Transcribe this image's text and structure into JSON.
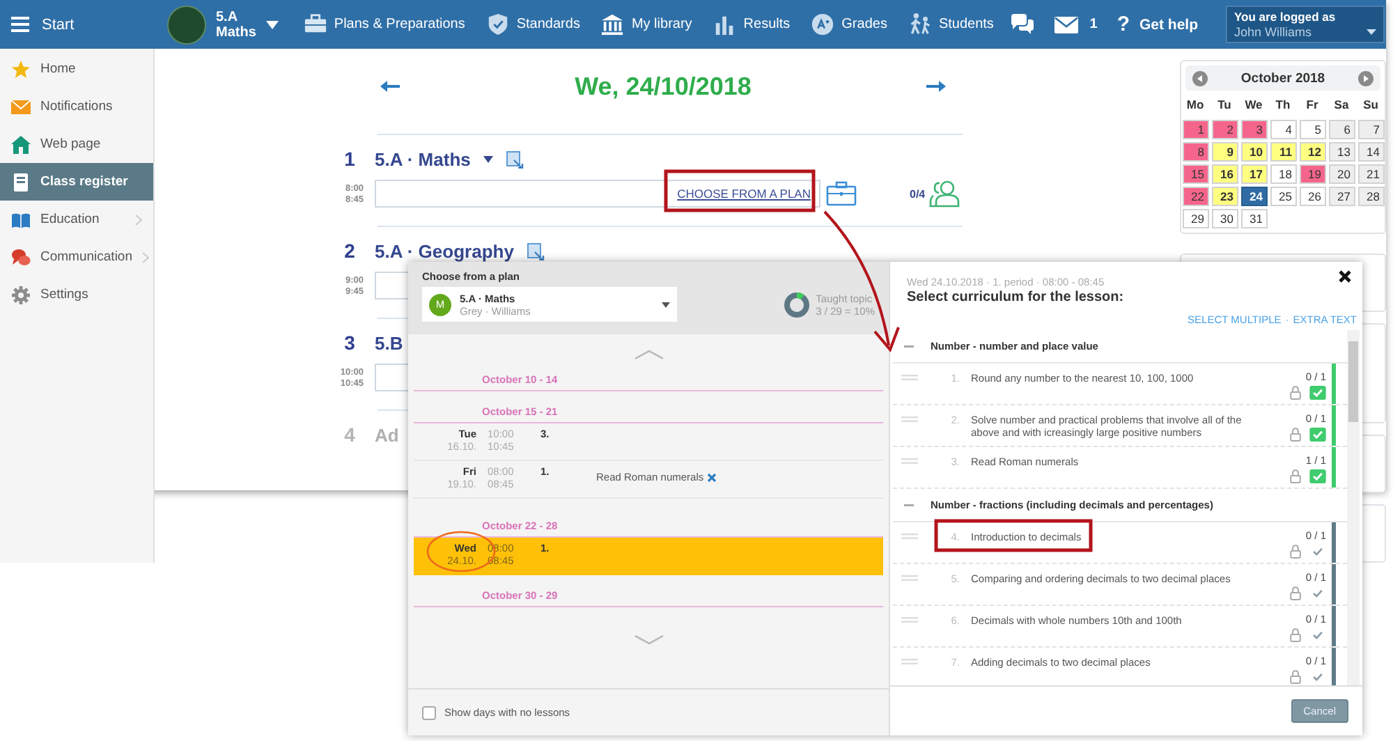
{
  "topbar": {
    "menu_label": "Start",
    "class": {
      "name": "5.A",
      "subject": "Maths"
    },
    "nav": [
      {
        "label": "Plans & Preparations",
        "kind": "plans"
      },
      {
        "label": "Standards",
        "kind": "standards"
      },
      {
        "label": "My library",
        "kind": "library"
      },
      {
        "label": "Results",
        "kind": "results"
      },
      {
        "label": "Grades",
        "kind": "grades"
      },
      {
        "label": "Students",
        "kind": "students"
      }
    ],
    "messages_count": "1",
    "help_mark": "?",
    "help": "Get help",
    "user": {
      "caption": "You are logged as",
      "name": "John Williams"
    }
  },
  "sidebar": {
    "items": [
      {
        "label": "Home",
        "kind": "star",
        "selected": false,
        "expandable": false
      },
      {
        "label": "Notifications",
        "kind": "envelope",
        "selected": false,
        "expandable": false
      },
      {
        "label": "Web page",
        "kind": "house",
        "selected": false,
        "expandable": false
      },
      {
        "label": "Class register",
        "kind": "notebook",
        "selected": true,
        "expandable": false
      },
      {
        "label": "Education",
        "kind": "book",
        "selected": false,
        "expandable": true
      },
      {
        "label": "Communication",
        "kind": "chat",
        "selected": false,
        "expandable": true
      },
      {
        "label": "Settings",
        "kind": "gear",
        "selected": false,
        "expandable": false
      }
    ]
  },
  "day": {
    "title": "We, 24/10/2018",
    "lessons": [
      {
        "kind": "lesson",
        "number": "1",
        "start": "8:00",
        "end": "8:45",
        "title": "5.A · Maths",
        "menu": true,
        "edit": true,
        "link": "CHOOSE FROM A PLAN",
        "attendance": "0/4"
      },
      {
        "kind": "lesson",
        "number": "2",
        "start": "9:00",
        "end": "9:45",
        "title": "5.A · Geography",
        "menu": false,
        "edit": true
      },
      {
        "kind": "lesson",
        "number": "3",
        "start": "10:00",
        "end": "10:45",
        "title": "5.B",
        "menu": false,
        "edit": false
      },
      {
        "kind": "add",
        "number": "4",
        "title": "Ad"
      }
    ]
  },
  "calendar": {
    "title": "October 2018",
    "weekdays": [
      "Mo",
      "Tu",
      "We",
      "Th",
      "Fr",
      "Sa",
      "Su"
    ],
    "days": [
      {
        "day": "1",
        "color": "#f5658b",
        "bold": false,
        "selected": false
      },
      {
        "day": "2",
        "color": "#f5658b",
        "bold": false,
        "selected": false
      },
      {
        "day": "3",
        "color": "#f5658b",
        "bold": false,
        "selected": false
      },
      {
        "day": "4",
        "color": "#ffffff",
        "bold": false,
        "selected": false
      },
      {
        "day": "5",
        "color": "#ffffff",
        "bold": false,
        "selected": false
      },
      {
        "day": "6",
        "color": "#eeeeee",
        "bold": false,
        "selected": false
      },
      {
        "day": "7",
        "color": "#eeeeee",
        "bold": false,
        "selected": false
      },
      {
        "day": "8",
        "color": "#f5658b",
        "bold": false,
        "selected": false
      },
      {
        "day": "9",
        "color": "#ffff80",
        "bold": true,
        "selected": false
      },
      {
        "day": "10",
        "color": "#ffff80",
        "bold": true,
        "selected": false
      },
      {
        "day": "11",
        "color": "#ffff80",
        "bold": true,
        "selected": false
      },
      {
        "day": "12",
        "color": "#ffff80",
        "bold": true,
        "selected": false
      },
      {
        "day": "13",
        "color": "#eeeeee",
        "bold": false,
        "selected": false
      },
      {
        "day": "14",
        "color": "#eeeeee",
        "bold": false,
        "selected": false
      },
      {
        "day": "15",
        "color": "#f5658b",
        "bold": false,
        "selected": false
      },
      {
        "day": "16",
        "color": "#ffff80",
        "bold": true,
        "selected": false
      },
      {
        "day": "17",
        "color": "#ffff80",
        "bold": true,
        "selected": false
      },
      {
        "day": "18",
        "color": "#ffffff",
        "bold": false,
        "selected": false
      },
      {
        "day": "19",
        "color": "#f5658b",
        "bold": false,
        "selected": false
      },
      {
        "day": "20",
        "color": "#eeeeee",
        "bold": false,
        "selected": false
      },
      {
        "day": "21",
        "color": "#eeeeee",
        "bold": false,
        "selected": false
      },
      {
        "day": "22",
        "color": "#f5658b",
        "bold": false,
        "selected": false
      },
      {
        "day": "23",
        "color": "#ffff80",
        "bold": true,
        "selected": false
      },
      {
        "day": "24",
        "color": "#2f6ca3",
        "bold": true,
        "selected": true
      },
      {
        "day": "25",
        "color": "#ffffff",
        "bold": false,
        "selected": false
      },
      {
        "day": "26",
        "color": "#ffffff",
        "bold": false,
        "selected": false
      },
      {
        "day": "27",
        "color": "#eeeeee",
        "bold": false,
        "selected": false
      },
      {
        "day": "28",
        "color": "#eeeeee",
        "bold": false,
        "selected": false
      },
      {
        "day": "29",
        "color": "#ffffff",
        "bold": false,
        "selected": false
      },
      {
        "day": "30",
        "color": "#ffffff",
        "bold": false,
        "selected": false
      },
      {
        "day": "31",
        "color": "#ffffff",
        "bold": false,
        "selected": false
      }
    ]
  },
  "dialog": {
    "left": {
      "title": "Choose from a plan",
      "plan": {
        "badge": "M",
        "name": "5.A · Maths",
        "teachers": "Grey · Williams"
      },
      "progress": {
        "label": "Taught topic",
        "value": "3 / 29 = 10%",
        "level": 0.1
      },
      "weeks": [
        {
          "title": "October 10 - 14"
        },
        {
          "title": "October 15 - 21",
          "lessons": [
            {
              "weekday": "Tue",
              "date": "16.10.",
              "start": "10:00",
              "end": "10:45",
              "period": "3.",
              "selected": false
            },
            {
              "weekday": "Fri",
              "date": "19.10.",
              "start": "08:00",
              "end": "08:45",
              "period": "1.",
              "topic": "Read Roman numerals",
              "selected": false
            }
          ]
        },
        {
          "title": "October 22 - 28",
          "lessons": [
            {
              "weekday": "Wed",
              "date": "24.10.",
              "start": "08:00",
              "end": "08:45",
              "period": "1.",
              "selected": true
            }
          ]
        },
        {
          "title": "October 30 - 29"
        }
      ],
      "show_empty": {
        "label": "Show days with no lessons",
        "checked": false
      }
    },
    "right": {
      "subtitle": "Wed 24.10.2018 · 1. period · 08:00 - 08:45",
      "title": "Select curriculum for the lesson:",
      "actions": [
        "SELECT MULTIPLE",
        "EXTRA TEXT"
      ],
      "actions_separator": "·",
      "groups": [
        {
          "title": "Number - number and place value",
          "items": [
            {
              "number": "1.",
              "text": "Round any number to the nearest 10, 100, 1000",
              "count": "0 / 1",
              "checked": true
            },
            {
              "number": "2.",
              "text": "Solve number and practical problems that involve all of the above and with icreasingly large positive numbers",
              "count": "0 / 1",
              "checked": true
            },
            {
              "number": "3.",
              "text": "Read Roman numerals",
              "count": "1 / 1",
              "checked": true
            }
          ]
        },
        {
          "title": "Number - fractions (including decimals and percentages)",
          "items": [
            {
              "number": "4.",
              "text": "Introduction to decimals",
              "count": "0 / 1",
              "checked": false
            },
            {
              "number": "5.",
              "text": "Comparing and ordering decimals to two decimal places",
              "count": "0 / 1",
              "checked": false
            },
            {
              "number": "6.",
              "text": "Decimals with whole numbers 10th and 100th",
              "count": "0 / 1",
              "checked": false
            },
            {
              "number": "7.",
              "text": "Adding decimals to two decimal places",
              "count": "0 / 1",
              "checked": false
            }
          ]
        }
      ],
      "cancel": "Cancel"
    }
  }
}
